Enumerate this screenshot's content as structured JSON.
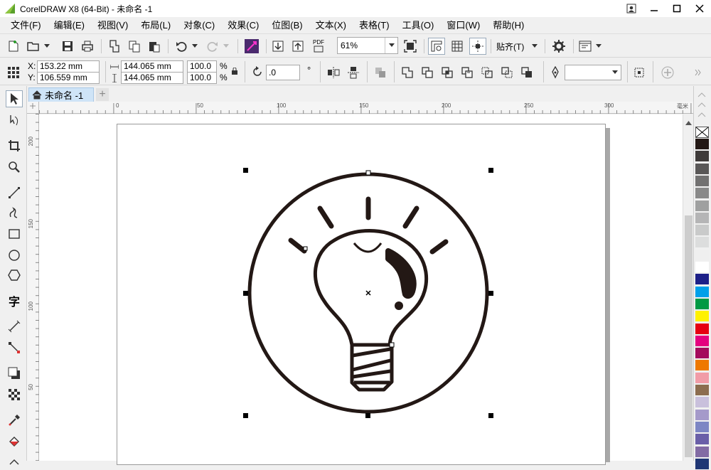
{
  "window": {
    "title": "CorelDRAW X8 (64-Bit) - 未命名 -1"
  },
  "menu": [
    "文件(F)",
    "编辑(E)",
    "视图(V)",
    "布局(L)",
    "对象(C)",
    "效果(C)",
    "位图(B)",
    "文本(X)",
    "表格(T)",
    "工具(O)",
    "窗口(W)",
    "帮助(H)"
  ],
  "toolbar": {
    "zoom": "61%",
    "snap_label": "贴齐(T)",
    "pdf_label": "PDF"
  },
  "property_bar": {
    "x_label": "X:",
    "x_value": "153.22 mm",
    "y_label": "Y:",
    "y_value": "106.559 mm",
    "width_value": "144.065 mm",
    "height_value": "144.065 mm",
    "scale_w": "100.0",
    "scale_h": "100.0",
    "percent": "%",
    "rotation": ".0",
    "degree": "°"
  },
  "document_tab": {
    "label": "未命名 -1",
    "add": "+"
  },
  "ruler": {
    "h_labels": [
      "0",
      "50",
      "100",
      "150",
      "200",
      "250",
      "300"
    ],
    "h_unit": "毫米",
    "v_labels": [
      "200",
      "150",
      "100",
      "50"
    ]
  },
  "palette": {
    "colors": [
      "#231815",
      "#3e3a39",
      "#595757",
      "#727171",
      "#898989",
      "#9fa0a0",
      "#b5b5b6",
      "#c9caca",
      "#dcdddd",
      "#efefef",
      "#ffffff",
      "#1d2088",
      "#00a0e9",
      "#009944",
      "#fff100",
      "#e60012",
      "#e4007f",
      "#a40b5d",
      "#ee7800",
      "#f19ca7",
      "#8c6d4f",
      "#c9c0dc",
      "#a59aca",
      "#7d86c4",
      "#6a5fa8",
      "#826ba4",
      "#1f3674"
    ]
  },
  "colors": {
    "ui_bg": "#f0f0f0",
    "tab_active": "#cfe4f7",
    "artwork": "#231815"
  }
}
